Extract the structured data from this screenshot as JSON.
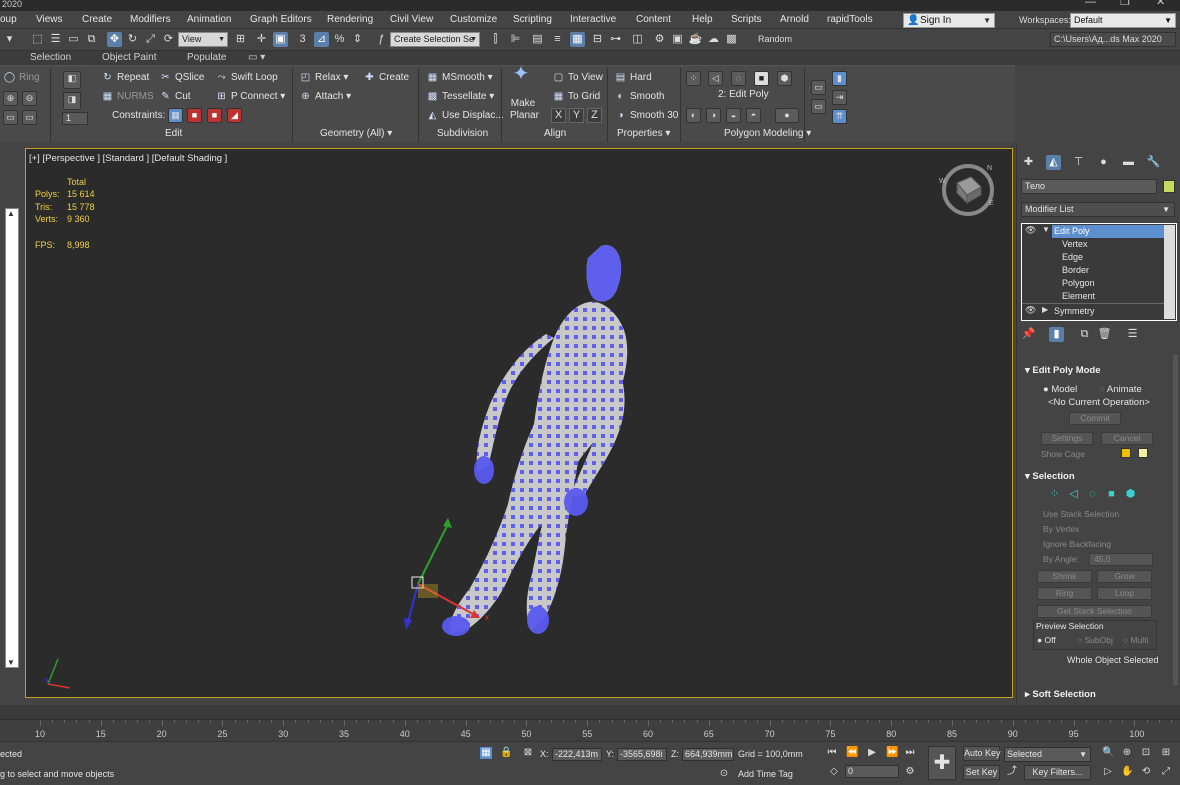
{
  "title_bar": {
    "text": "2020"
  },
  "menubar": {
    "items": [
      "oup",
      "Views",
      "Create",
      "Modifiers",
      "Animation",
      "Graph Editors",
      "Rendering",
      "Civil View",
      "Customize",
      "Scripting",
      "Interactive",
      "Content",
      "Help",
      "Scripts",
      "Arnold",
      "rapidTools"
    ],
    "sign_in": "Sign In",
    "workspaces_label": "Workspaces:",
    "workspace_value": "Default"
  },
  "toolbar": {
    "view_combo": "View",
    "selection_set": "Create Selection Se",
    "random_label": "Random",
    "path": "C:\\Users\\Ад...ds Max 2020"
  },
  "ribbon_tabs": [
    "Selection",
    "Object Paint",
    "Populate"
  ],
  "ribbon": {
    "ring": "Ring",
    "nurms": "NURMS",
    "repeat": "Repeat",
    "qslice": "QSlice",
    "swift_loop": "Swift Loop",
    "cut": "Cut",
    "p_connect": "P Connect",
    "constraints": "Constraints:",
    "relax": "Relax",
    "create": "Create",
    "attach": "Attach",
    "msmooth": "MSmooth",
    "tessellate": "Tessellate",
    "use_displace": "Use Displac...",
    "make_planar": "Make Planar",
    "to_view": "To View",
    "to_grid": "To Grid",
    "hard": "Hard",
    "smooth": "Smooth",
    "smooth30": "Smooth 30",
    "edit_poly_level": "2: Edit Poly",
    "groups": {
      "edit": "Edit",
      "geometry": "Geometry (All)",
      "subdivision": "Subdivision",
      "align": "Align",
      "properties": "Properties",
      "polygon_modeling": "Polygon Modeling"
    },
    "x": "X",
    "y": "Y",
    "z": "Z",
    "spin_value": "1"
  },
  "viewport": {
    "label": "[+] [Perspective ] [Standard ] [Default Shading ]",
    "stats": {
      "total": "Total",
      "polys_label": "Polys:",
      "polys": "15 614",
      "tris_label": "Tris:",
      "tris": "15 778",
      "verts_label": "Verts:",
      "verts": "9 360",
      "fps_label": "FPS:",
      "fps": "8,998"
    },
    "gizmo_x": "x",
    "colors": {
      "mesh": "#c8c8c8",
      "selection": "#5a5af0",
      "border": "#c8a020"
    }
  },
  "command_panel": {
    "object_name": "Тело",
    "modifier_list": "Modifier List",
    "stack": [
      {
        "label": "Edit Poly",
        "selected": true
      },
      {
        "label": "Vertex"
      },
      {
        "label": "Edge"
      },
      {
        "label": "Border"
      },
      {
        "label": "Polygon"
      },
      {
        "label": "Element"
      },
      {
        "label": "Symmetry"
      }
    ],
    "edit_poly_mode": "Edit Poly Mode",
    "model": "Model",
    "animate": "Animate",
    "no_op": "<No Current Operation>",
    "commit": "Commit",
    "settings": "Settings",
    "cancel": "Cancel",
    "show_cage": "Show Cage",
    "selection": "Selection",
    "use_stack_selection": "Use Stack Selection",
    "by_vertex": "By Vertex",
    "ignore_backfacing": "Ignore Backfacing",
    "by_angle": "By Angle:",
    "angle_value": "45,0",
    "shrink": "Shrink",
    "grow": "Grow",
    "ring": "Ring",
    "loop": "Loop",
    "get_stack_selection": "Get Stack Selection",
    "preview_selection": "Preview Selection",
    "off": "Off",
    "subobj": "SubObj",
    "multi": "Multi",
    "whole_object_selected": "Whole Object Selected",
    "soft_selection": "Soft Selection"
  },
  "timeline": {
    "ticks": [
      "10",
      "15",
      "20",
      "25",
      "30",
      "35",
      "40",
      "45",
      "50",
      "55",
      "60",
      "65",
      "70",
      "75",
      "80",
      "85",
      "90",
      "95",
      "100"
    ]
  },
  "status": {
    "selected_text": "ected",
    "prompt": "g to select and move objects",
    "x_label": "X:",
    "x_value": "-222,413m",
    "y_label": "Y:",
    "y_value": "-3565,698i",
    "z_label": "Z:",
    "z_value": "664,939mm",
    "grid": "Grid = 100,0mm",
    "add_time_tag": "Add Time Tag",
    "auto_key": "Auto Key",
    "set_key": "Set Key",
    "selected_combo": "Selected",
    "key_filters": "Key Filters...",
    "frame": "0"
  }
}
